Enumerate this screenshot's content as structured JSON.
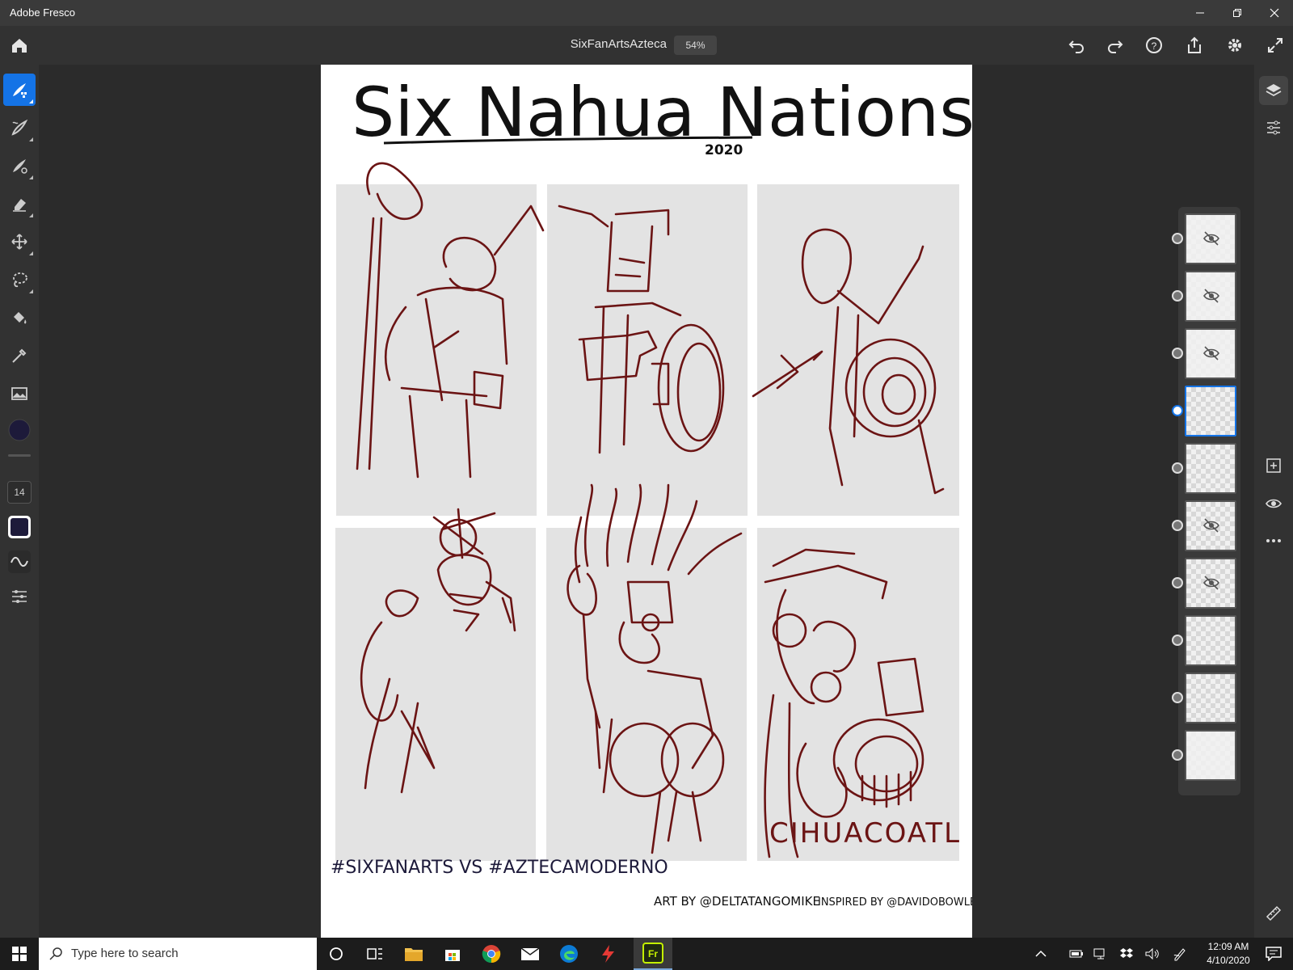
{
  "window": {
    "title": "Adobe Fresco"
  },
  "appbar": {
    "document_name": "SixFanArtsAzteca",
    "zoom": "54%"
  },
  "tools": [
    {
      "name": "pixel-brush",
      "active": true
    },
    {
      "name": "live-brush"
    },
    {
      "name": "vector-brush"
    },
    {
      "name": "eraser"
    },
    {
      "name": "move-transform"
    },
    {
      "name": "lasso-selection"
    },
    {
      "name": "fill"
    },
    {
      "name": "eyedropper"
    },
    {
      "name": "place-image"
    }
  ],
  "brush": {
    "size": "14",
    "color": "#1d1a3a"
  },
  "artwork": {
    "title": "Six Nahua Nations",
    "year": "2020",
    "hashtag": "#SixFanArts vs #AztecaModerno",
    "credit_art": "Art by @DeltaTangoMike",
    "credit_inspired": "Inspired by @DavidOBowles",
    "panel_label": "Cihuacoatl",
    "stroke_color": "#6b1414",
    "panel_color": "#e3e3e3"
  },
  "layers": [
    {
      "hidden": true
    },
    {
      "hidden": true
    },
    {
      "hidden": true
    },
    {
      "hidden": false,
      "selected": true
    },
    {
      "hidden": false
    },
    {
      "hidden": true
    },
    {
      "hidden": true
    },
    {
      "hidden": false
    },
    {
      "hidden": false
    },
    {
      "hidden": false,
      "type": "image"
    }
  ],
  "taskbar": {
    "search_placeholder": "Type here to search",
    "time": "12:09 AM",
    "date": "4/10/2020",
    "fresco_label": "Fr"
  },
  "colors": {
    "accent": "#1473e6"
  }
}
